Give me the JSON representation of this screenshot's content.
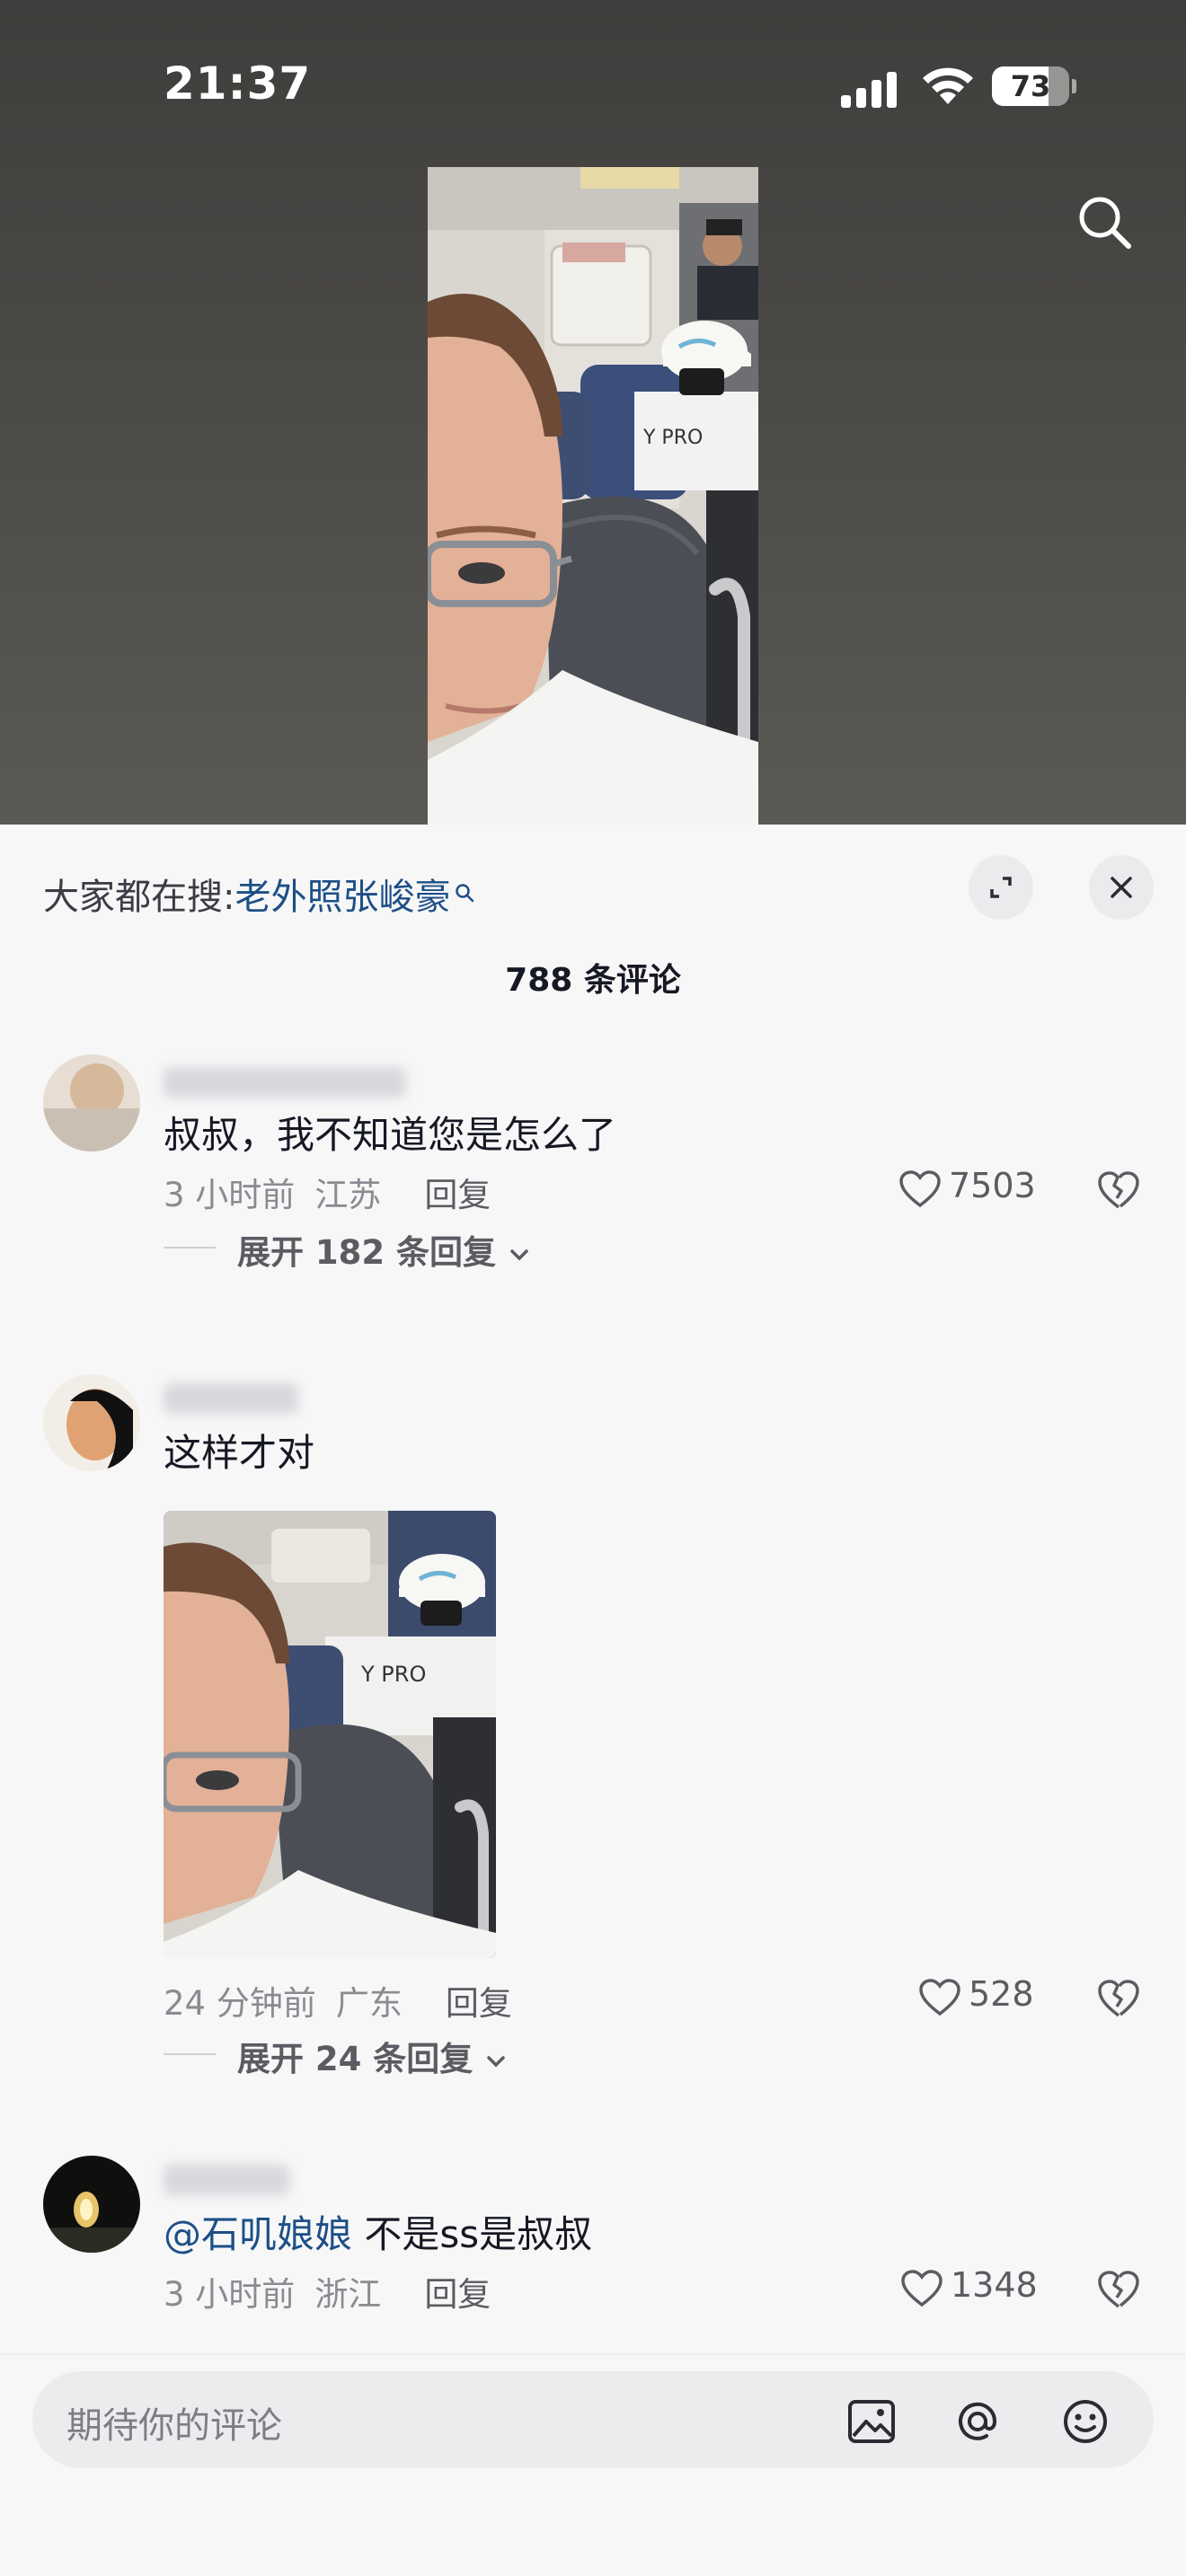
{
  "status_bar": {
    "time": "21:37",
    "battery": "73",
    "battery_fraction": 0.73
  },
  "sheet": {
    "search_prefix": "大家都在搜:",
    "search_keyword": "老外照张峻豪",
    "comment_count": "788 条评论"
  },
  "comments": [
    {
      "text": "叔叔，我不知道您是怎么了",
      "time": "3 小时前",
      "location": "江苏",
      "reply_label": "回复",
      "likes": "7503",
      "expand_label": "展开 182 条回复"
    },
    {
      "text": "这样才对",
      "time": "24 分钟前",
      "location": "广东",
      "reply_label": "回复",
      "likes": "528",
      "expand_label": "展开 24 条回复"
    },
    {
      "mention": "@石叽娘娘",
      "text": " 不是ss是叔叔",
      "time": "3 小时前",
      "location": "浙江",
      "reply_label": "回复",
      "likes": "1348"
    }
  ],
  "input": {
    "placeholder": "期待你的评论"
  },
  "icons": [
    "search-icon",
    "expand-icon",
    "close-icon",
    "heart-icon",
    "dislike-icon",
    "chevron-down-icon",
    "image-icon",
    "at-icon",
    "emoji-icon"
  ],
  "colors": {
    "link": "#1d4f86",
    "sheet_bg": "#f7f7f8",
    "meta_text": "#8a8b91"
  }
}
